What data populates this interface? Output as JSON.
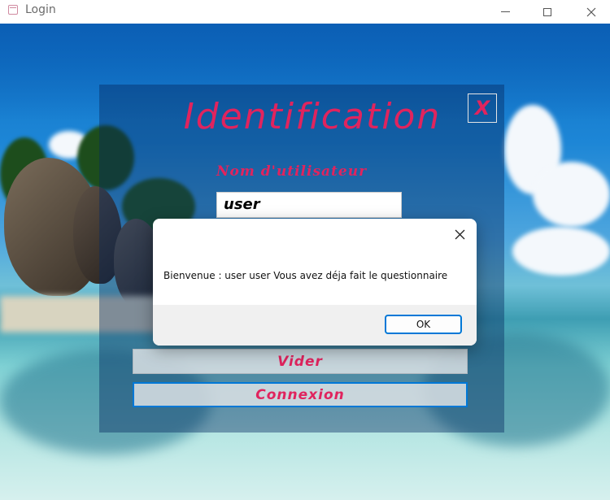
{
  "window": {
    "title": "Login",
    "icons": [
      "app-icon",
      "minimize-icon",
      "maximize-icon",
      "close-icon"
    ]
  },
  "login": {
    "heading": "Identification",
    "close_label": "X",
    "username_label": "Nom d'utilisateur",
    "username_value": "user",
    "clear_button": "Vider",
    "connect_button": "Connexion"
  },
  "dialog": {
    "message": "Bienvenue : user user Vous avez déja fait le questionnaire",
    "ok_button": "OK",
    "close_icon": "close-icon"
  },
  "colors": {
    "accent": "#e0245e",
    "focus": "#0078d7"
  }
}
